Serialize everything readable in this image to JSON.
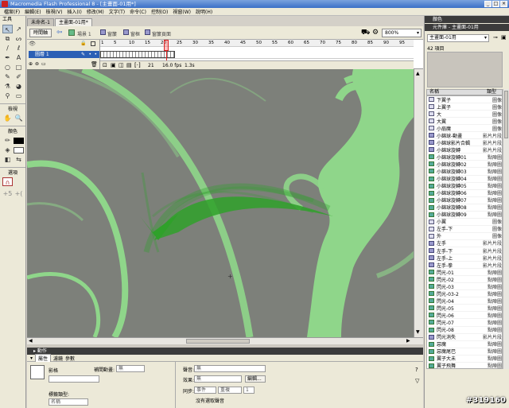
{
  "window": {
    "title": "Macromedia Flash Professional 8 - [主畫面-01用*]",
    "buttons": [
      "_",
      "□",
      "×"
    ]
  },
  "menu": [
    "檔案(F)",
    "編輯(E)",
    "檢視(V)",
    "插入(I)",
    "修改(M)",
    "文字(T)",
    "命令(C)",
    "控制(O)",
    "視窗(W)",
    "說明(H)"
  ],
  "tools": {
    "title": "工具",
    "items": [
      "arrow",
      "subselect",
      "free-transform",
      "lasso",
      "line",
      "pen",
      "text",
      "oval",
      "rectangle",
      "pencil",
      "brush",
      "ink-bottle",
      "paint-bucket",
      "eyedropper",
      "eraser"
    ],
    "view_label": "檢視",
    "colors_label": "顏色",
    "options_label": "選項"
  },
  "doc_tabs": [
    "未命名-1",
    "主畫面-01用*"
  ],
  "editbar": {
    "timeline_btn": "時間軸",
    "scene": "場景 1",
    "symbols": [
      "窗簾",
      "窗框",
      "窗簾頁面"
    ],
    "zoom": "800%"
  },
  "timeline": {
    "layer_name": "圖層 1",
    "frame_numbers": [
      "1",
      "5",
      "10",
      "15",
      "20",
      "25",
      "30",
      "35",
      "40",
      "45",
      "50",
      "55",
      "60",
      "65",
      "70",
      "75",
      "80",
      "85",
      "90",
      "95"
    ],
    "frame": "21",
    "fps": "16.0 fps",
    "time": "1.3s"
  },
  "actions_panel": {
    "title": "動作"
  },
  "props": {
    "tabs": [
      "屬性",
      "濾鏡",
      "參數"
    ],
    "symbol_label": "影格",
    "tween_label": "補間動畫:",
    "tween_value": "無",
    "label_type_label": "標籤類型:",
    "label_type_value": "名稱",
    "sound_label": "聲音:",
    "sound_value": "無",
    "effect_label": "效果:",
    "effect_value": "無",
    "edit_btn": "編輯...",
    "sync_label": "同步:",
    "sync_value": "事件",
    "repeat_value": "重複",
    "repeat_count": "1",
    "no_sound": "沒有選取聲音"
  },
  "color_panel": {
    "title": "顏色"
  },
  "library": {
    "title": "元件庫 - 主畫面-01用",
    "doc_select": "主畫面-01用",
    "count": "42 項目",
    "col_name": "名稱",
    "col_type": "類型",
    "items": [
      {
        "name": "下翼子",
        "type": "圖像",
        "icon": "gr"
      },
      {
        "name": "上翼子",
        "type": "圖像",
        "icon": "gr"
      },
      {
        "name": "大",
        "type": "圖像",
        "icon": "gr"
      },
      {
        "name": "大翼",
        "type": "圖像",
        "icon": "gr"
      },
      {
        "name": "小扇魔",
        "type": "圖像",
        "icon": "gr"
      },
      {
        "name": "小錦球-動畫",
        "type": "影片片段",
        "icon": "mc"
      },
      {
        "name": "小錦球影片合輯",
        "type": "影片片段",
        "icon": "mc"
      },
      {
        "name": "小錦球旋轉",
        "type": "影片片段",
        "icon": "mc"
      },
      {
        "name": "小錦球旋轉01",
        "type": "點陣圖",
        "icon": "btn"
      },
      {
        "name": "小錦球旋轉02",
        "type": "點陣圖",
        "icon": "btn"
      },
      {
        "name": "小錦球旋轉03",
        "type": "點陣圖",
        "icon": "btn"
      },
      {
        "name": "小錦球旋轉04",
        "type": "點陣圖",
        "icon": "btn"
      },
      {
        "name": "小錦球旋轉05",
        "type": "點陣圖",
        "icon": "btn"
      },
      {
        "name": "小錦球旋轉06",
        "type": "點陣圖",
        "icon": "btn"
      },
      {
        "name": "小錦球旋轉07",
        "type": "點陣圖",
        "icon": "btn"
      },
      {
        "name": "小錦球旋轉08",
        "type": "點陣圖",
        "icon": "btn"
      },
      {
        "name": "小錦球旋轉09",
        "type": "點陣圖",
        "icon": "btn"
      },
      {
        "name": "小翼",
        "type": "圖像",
        "icon": "gr"
      },
      {
        "name": "左手-下",
        "type": "圖像",
        "icon": "gr"
      },
      {
        "name": "外",
        "type": "圖像",
        "icon": "gr"
      },
      {
        "name": "左手",
        "type": "影片片段",
        "icon": "mc"
      },
      {
        "name": "左手-下",
        "type": "影片片段",
        "icon": "mc"
      },
      {
        "name": "左手-上",
        "type": "影片片段",
        "icon": "mc"
      },
      {
        "name": "左手-拳",
        "type": "影片片段",
        "icon": "mc"
      },
      {
        "name": "閃光-01",
        "type": "點陣圖",
        "icon": "btn"
      },
      {
        "name": "閃光-02",
        "type": "點陣圖",
        "icon": "btn"
      },
      {
        "name": "閃光-03",
        "type": "點陣圖",
        "icon": "btn"
      },
      {
        "name": "閃光-03-2",
        "type": "點陣圖",
        "icon": "btn"
      },
      {
        "name": "閃光-04",
        "type": "點陣圖",
        "icon": "btn"
      },
      {
        "name": "閃光-05",
        "type": "點陣圖",
        "icon": "btn"
      },
      {
        "name": "閃光-06",
        "type": "點陣圖",
        "icon": "btn"
      },
      {
        "name": "閃光-07",
        "type": "點陣圖",
        "icon": "btn"
      },
      {
        "name": "閃光-08",
        "type": "點陣圖",
        "icon": "btn"
      },
      {
        "name": "閃光消失",
        "type": "影片片段",
        "icon": "mc"
      },
      {
        "name": "惡魔",
        "type": "點陣圖",
        "icon": "btn"
      },
      {
        "name": "惡魔尾巴",
        "type": "點陣圖",
        "icon": "btn"
      },
      {
        "name": "翼子大未",
        "type": "點陣圖",
        "icon": "btn"
      },
      {
        "name": "翼子飛舞",
        "type": "點陣圖",
        "icon": "btn"
      }
    ]
  },
  "watermark": "#319160",
  "colors": {
    "stage_bg": "#7d807a",
    "shape_green": "#8fd68a",
    "arrow_green": "#2fa12a"
  }
}
